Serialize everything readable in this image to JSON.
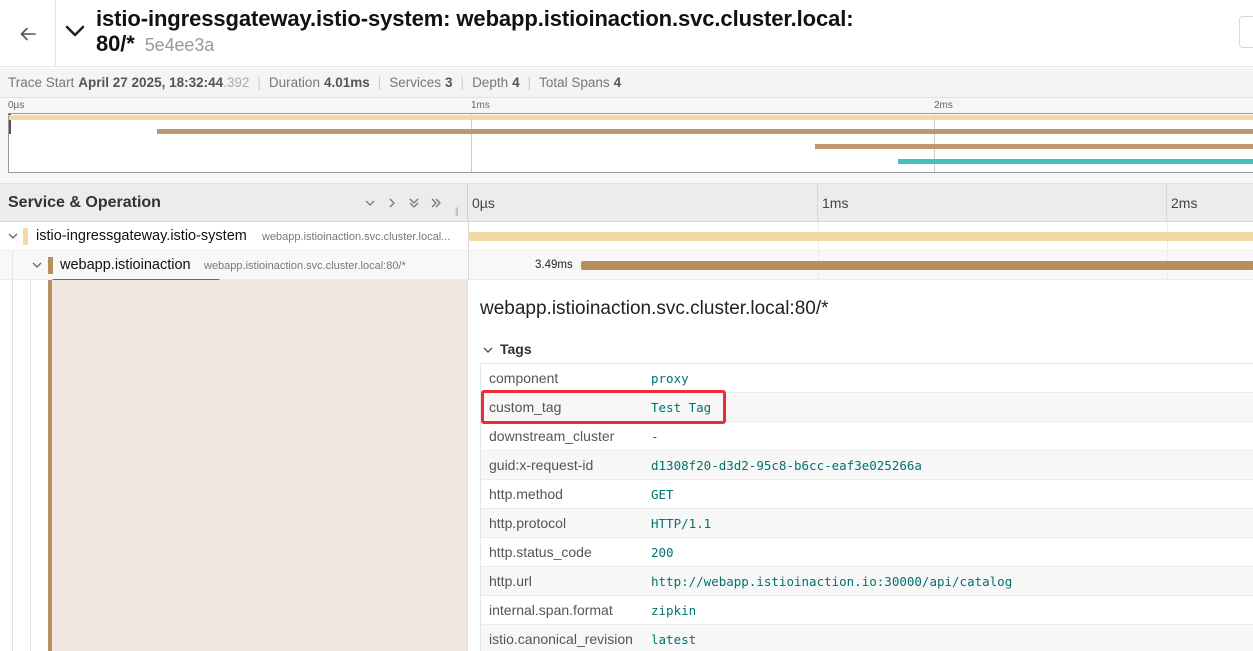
{
  "header": {
    "title_line1": "istio-ingressgateway.istio-system: webapp.istioinaction.svc.cluster.local:",
    "title_line2": "80/*",
    "trace_id": "5e4ee3a"
  },
  "summary": {
    "trace_start_label": "Trace Start",
    "trace_start_date": "April 27 2025, 18:32:44",
    "trace_start_ms": ".392",
    "duration_label": "Duration",
    "duration_value": "4.01ms",
    "services_label": "Services",
    "services_value": "3",
    "depth_label": "Depth",
    "depth_value": "4",
    "total_spans_label": "Total Spans",
    "total_spans_value": "4"
  },
  "minimap": {
    "ticks": [
      "0µs",
      "1ms",
      "2ms"
    ],
    "bars": [
      {
        "start_ms": 0.0,
        "end_ms": 4.01,
        "color": "#f3d9a1"
      },
      {
        "start_ms": 0.32,
        "end_ms": 4.01,
        "color": "#c0976e"
      },
      {
        "start_ms": 1.74,
        "end_ms": 4.01,
        "color": "#c0976e"
      },
      {
        "start_ms": 1.92,
        "end_ms": 4.01,
        "color": "#45bfbf"
      }
    ]
  },
  "columns": {
    "service_operation": "Service & Operation",
    "timeline_ticks": [
      "0µs",
      "1ms",
      "2ms"
    ]
  },
  "rows": [
    {
      "service": "istio-ingressgateway.istio-system",
      "operation": "webapp.istioinaction.svc.cluster.local...",
      "color": "#f3d9a1",
      "duration_label": ""
    },
    {
      "service": "webapp.istioinaction",
      "operation": "webapp.istioinaction.svc.cluster.local:80/*",
      "color": "#b88e5f",
      "duration_label": "3.49ms"
    }
  ],
  "detail": {
    "title": "webapp.istioinaction.svc.cluster.local:80/*",
    "tags_label": "Tags",
    "tags": [
      {
        "key": "component",
        "value": "proxy"
      },
      {
        "key": "custom_tag",
        "value": "Test Tag"
      },
      {
        "key": "downstream_cluster",
        "value": "-"
      },
      {
        "key": "guid:x-request-id",
        "value": "d1308f20-d3d2-95c8-b6cc-eaf3e025266a"
      },
      {
        "key": "http.method",
        "value": "GET"
      },
      {
        "key": "http.protocol",
        "value": "HTTP/1.1"
      },
      {
        "key": "http.status_code",
        "value": "200"
      },
      {
        "key": "http.url",
        "value": "http://webapp.istioinaction.io:30000/api/catalog"
      },
      {
        "key": "internal.span.format",
        "value": "zipkin"
      },
      {
        "key": "istio.canonical_revision",
        "value": "latest"
      }
    ]
  },
  "icons": {
    "back": "arrow-left-icon",
    "toggle": "chevron-down-icon",
    "collapse_one": "chevron-down-icon",
    "expand_one": "chevron-right-icon",
    "collapse_all": "double-chevron-down-icon",
    "expand_all": "double-chevron-right-icon"
  },
  "colors": {
    "highlight": "#ee2c37",
    "tag_value": "#00736e",
    "ingress": "#f3d9a1",
    "webapp": "#b88e5f",
    "teal": "#45bfbf"
  }
}
